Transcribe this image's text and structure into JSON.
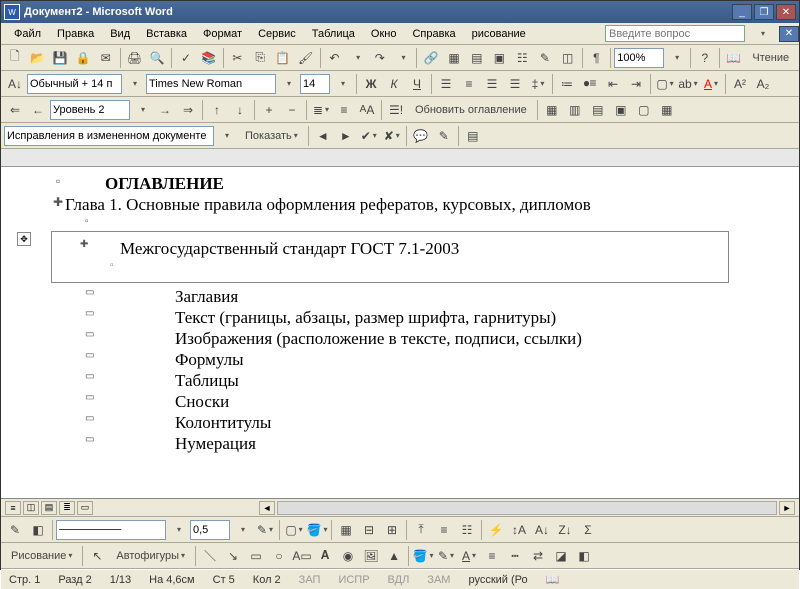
{
  "title": "Документ2 - Microsoft Word",
  "menu": [
    "Файл",
    "Правка",
    "Вид",
    "Вставка",
    "Формат",
    "Сервис",
    "Таблица",
    "Окно",
    "Справка",
    "рисование"
  ],
  "askbox_placeholder": "Введите вопрос",
  "zoom": "100%",
  "reading_label": "Чтение",
  "style": "Обычный + 14 п",
  "font": "Times New Roman",
  "size": "14",
  "outline_level": "Уровень 2",
  "update_toc_label": "Обновить оглавление",
  "track_mode": "Исправления в измененном документе",
  "show_label": "Показать",
  "line_weight": "0,5",
  "drawing_label": "Рисование",
  "autoshapes_label": "Автофигуры",
  "doc": {
    "title": "ОГЛАВЛЕНИЕ",
    "chapter": "Глава 1. Основные правила оформления рефератов, курсовых, дипломов",
    "boxed": "Межгосударственный стандарт ГОСТ 7.1-2003",
    "items": [
      "Заглавия",
      "Текст (границы, абзацы, размер шрифта, гарнитуры)",
      "Изображения (расположение в тексте, подписи, ссылки)",
      "Формулы",
      "Таблицы",
      "Сноски",
      "Колонтитулы",
      "Нумерация"
    ]
  },
  "status": {
    "page": "Стр. 1",
    "section": "Разд 2",
    "pages": "1/13",
    "at": "На 4,6см",
    "line": "Ст 5",
    "col": "Кол 2",
    "rec": "ЗАП",
    "trk": "ИСПР",
    "ext": "ВДЛ",
    "ovr": "ЗАМ",
    "lang": "русский (Ро"
  }
}
